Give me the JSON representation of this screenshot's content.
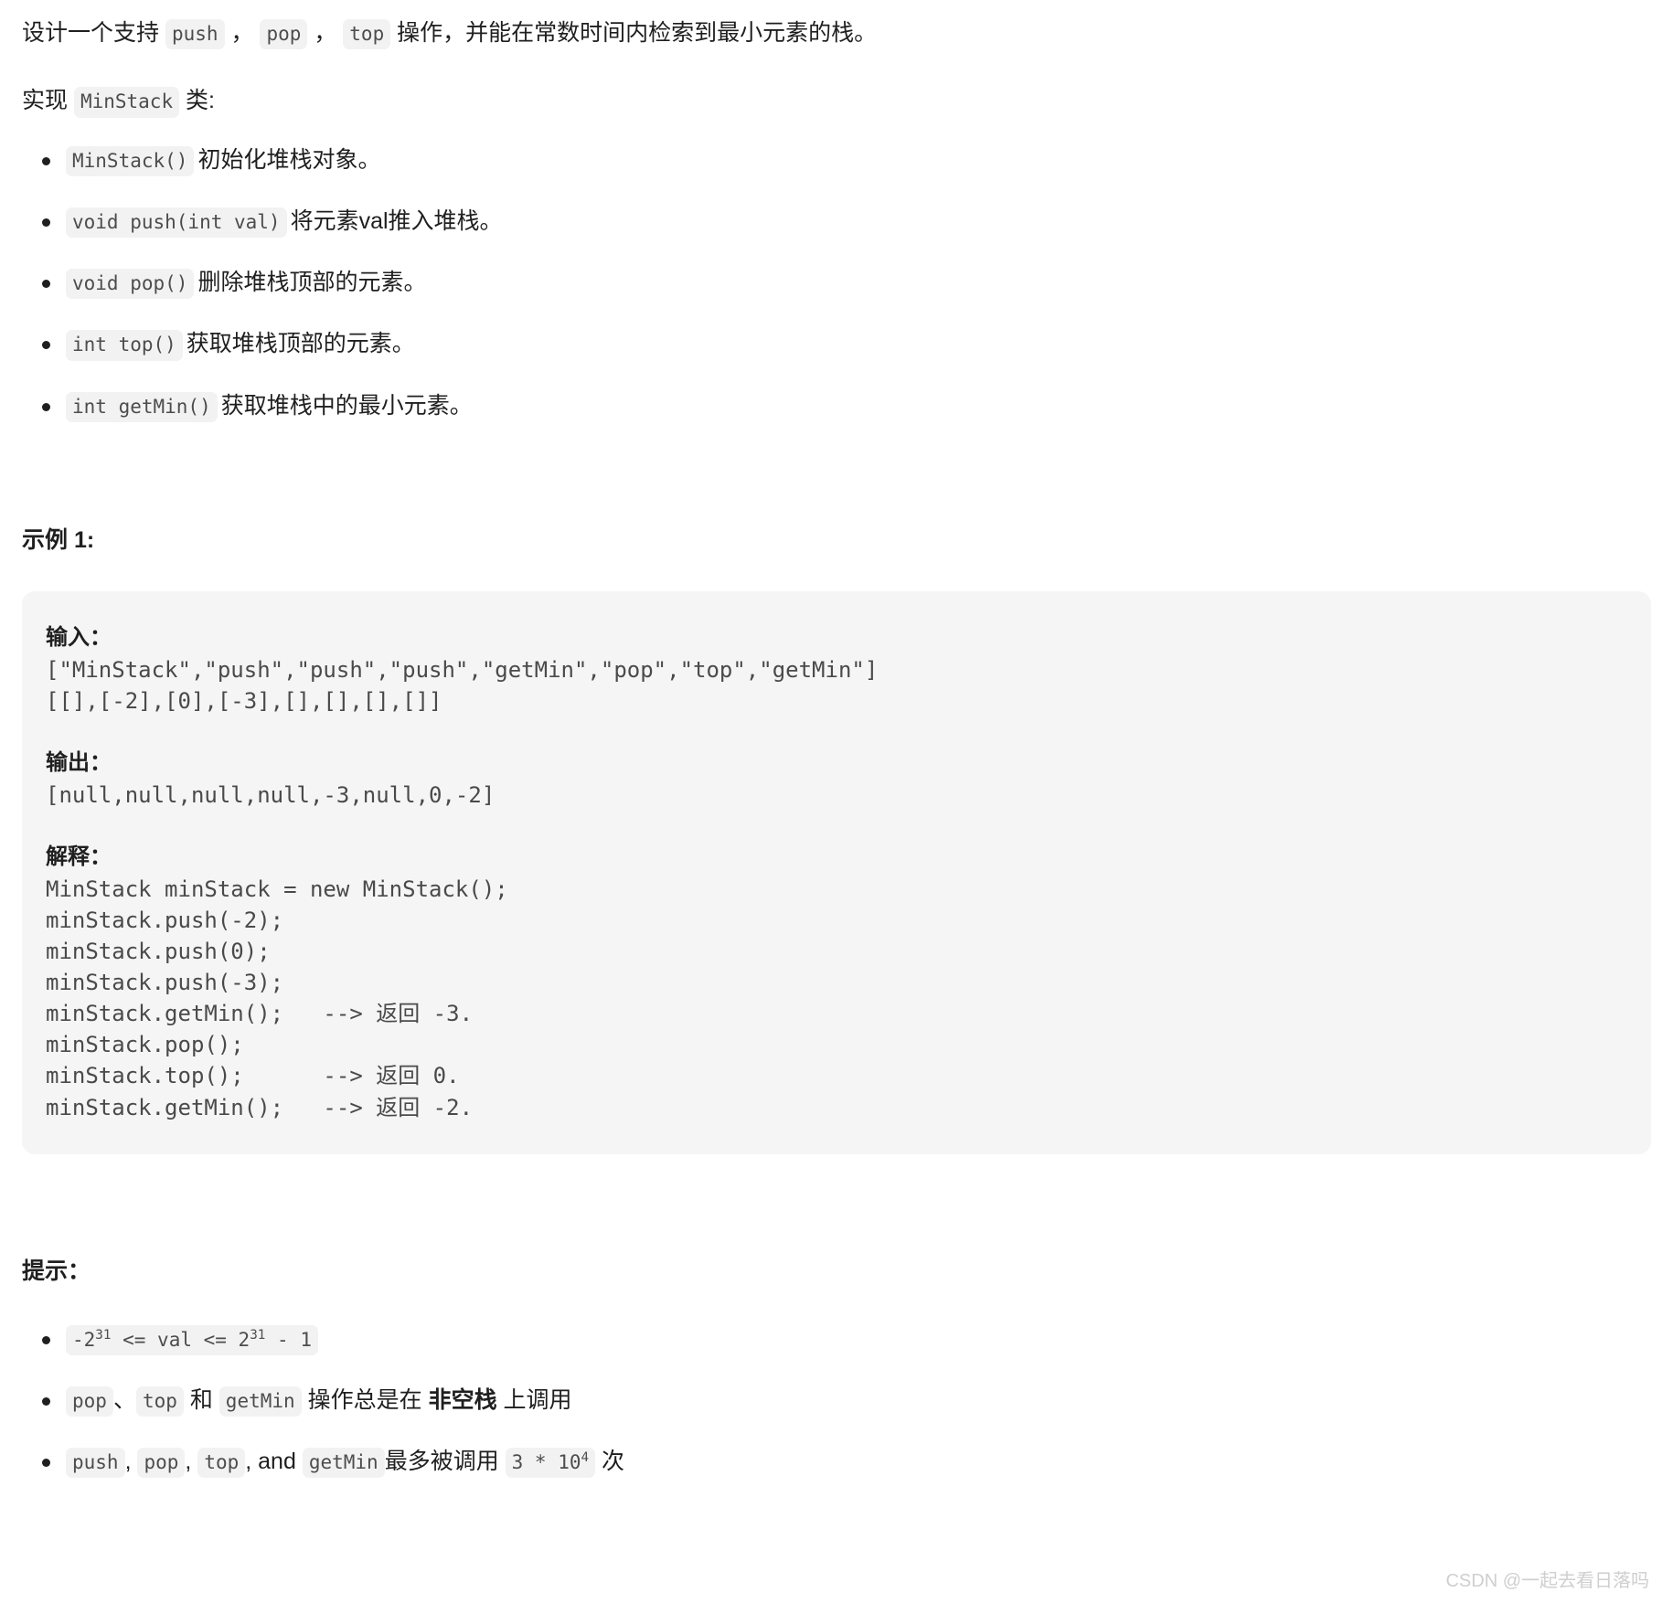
{
  "intro": {
    "line1_pre": "设计一个支持 ",
    "chip_push": "push",
    "sep1": " ， ",
    "chip_pop": "pop",
    "sep2": " ， ",
    "chip_top": "top",
    "line1_post": " 操作，并能在常数时间内检索到最小元素的栈。",
    "line2_pre": "实现 ",
    "chip_minstack": "MinStack",
    "line2_post": " 类:"
  },
  "methods": [
    {
      "code": "MinStack()",
      "desc": "初始化堆栈对象。"
    },
    {
      "code": "void push(int val)",
      "desc": "将元素val推入堆栈。"
    },
    {
      "code": "void pop()",
      "desc": "删除堆栈顶部的元素。"
    },
    {
      "code": "int top()",
      "desc": "获取堆栈顶部的元素。"
    },
    {
      "code": "int getMin()",
      "desc": "获取堆栈中的最小元素。"
    }
  ],
  "example": {
    "title": "示例 1:",
    "input_label": "输入：",
    "input_code": "[\"MinStack\",\"push\",\"push\",\"push\",\"getMin\",\"pop\",\"top\",\"getMin\"]\n[[],[-2],[0],[-3],[],[],[],[]]",
    "output_label": "输出：",
    "output_code": "[null,null,null,null,-3,null,0,-2]",
    "explain_label": "解释：",
    "explain_code": "MinStack minStack = new MinStack();\nminStack.push(-2);\nminStack.push(0);\nminStack.push(-3);\nminStack.getMin();   --> 返回 -3.\nminStack.pop();\nminStack.top();      --> 返回 0.\nminStack.getMin();   --> 返回 -2."
  },
  "hints": {
    "title": "提示：",
    "hint1": {
      "base_neg": "-2",
      "exp1": "31",
      "mid": " <= val <= 2",
      "exp2": "31",
      "tail": " - 1"
    },
    "hint2": {
      "chip_pop": "pop",
      "sep1": "、",
      "chip_top": "top",
      "mid": " 和 ",
      "chip_getmin": "getMin",
      "text_a": " 操作总是在 ",
      "bold": "非空栈",
      "text_b": " 上调用"
    },
    "hint3": {
      "chip_push": "push",
      "sep1": ", ",
      "chip_pop": "pop",
      "sep2": ", ",
      "chip_top": "top",
      "sep3": ", and ",
      "chip_getmin": "getMin",
      "text_a": "最多被调用 ",
      "chip_count_base": "3 * 10",
      "chip_count_exp": "4",
      "text_b": " 次"
    }
  },
  "watermark": "CSDN @一起去看日落吗",
  "colors": {
    "text": "#1f1f1f",
    "code_text": "#4a4a4a",
    "chip_bg": "#f2f2f2",
    "codeblock_bg": "#f5f5f5",
    "watermark": "#cfcfcf"
  }
}
